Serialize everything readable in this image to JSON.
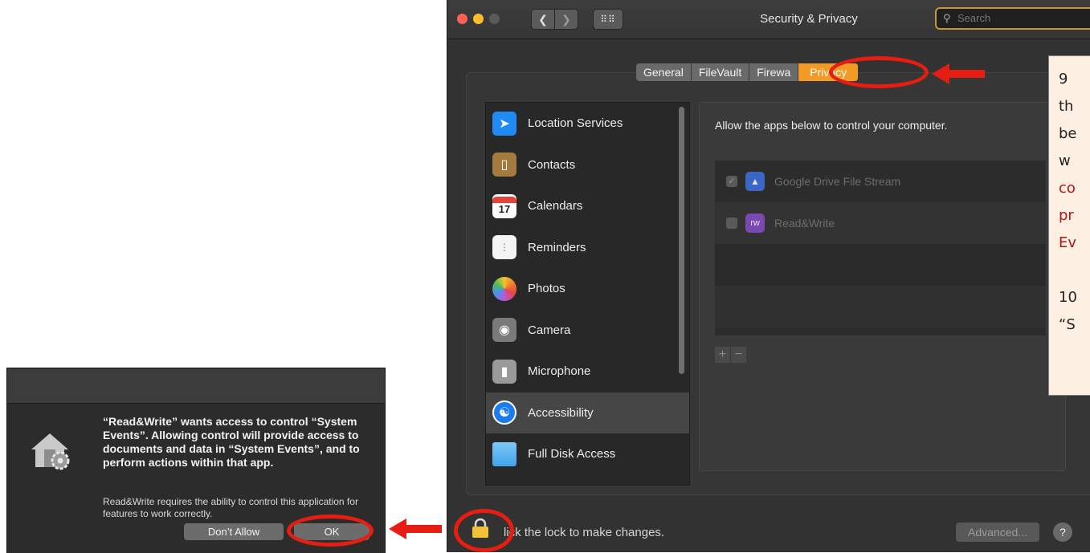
{
  "window": {
    "title": "Security & Privacy",
    "search_placeholder": "Search",
    "grid_glyph": "⠿⠿"
  },
  "tabs": [
    {
      "label": "General"
    },
    {
      "label": "FileVault"
    },
    {
      "label": "Firewa"
    },
    {
      "label": "Privacy",
      "active": true
    }
  ],
  "sidebar": {
    "items": [
      {
        "label": "Location Services",
        "icon": "location-arrow-icon"
      },
      {
        "label": "Contacts",
        "icon": "contacts-book-icon"
      },
      {
        "label": "Calendars",
        "icon": "calendar-icon",
        "glyph": "17"
      },
      {
        "label": "Reminders",
        "icon": "reminders-list-icon"
      },
      {
        "label": "Photos",
        "icon": "photos-flower-icon"
      },
      {
        "label": "Camera",
        "icon": "camera-icon"
      },
      {
        "label": "Microphone",
        "icon": "microphone-icon"
      },
      {
        "label": "Accessibility",
        "icon": "accessibility-icon",
        "selected": true
      },
      {
        "label": "Full Disk Access",
        "icon": "folder-icon"
      }
    ]
  },
  "panel": {
    "heading": "Allow the apps below to control your computer.",
    "apps": [
      {
        "name": "Google Drive File Stream",
        "checked": true
      },
      {
        "name": "Read&Write",
        "checked": false,
        "icon_text": "rw"
      }
    ],
    "add_label": "+",
    "remove_label": "−"
  },
  "footer": {
    "lock_text": "lick the lock to make changes.",
    "advanced_label": "Advanced...",
    "help_label": "?"
  },
  "callout": {
    "lines": [
      "9",
      "th",
      "be",
      "w"
    ],
    "red_lines": [
      "co",
      "pr",
      "Ev"
    ],
    "lines2": [
      "10",
      "“S"
    ]
  },
  "dialog": {
    "heading": "“Read&Write” wants access to control “System Events”. Allowing control will provide access to documents and data in “System Events”, and to perform actions within that app.",
    "body": "Read&Write requires the ability to control this application for features to work correctly.",
    "dont_allow_label": "Don’t Allow",
    "ok_label": "OK"
  },
  "colors": {
    "accent": "#f39a24",
    "annotation_red": "#e51d12",
    "callout_bg": "#fdf0e3"
  }
}
